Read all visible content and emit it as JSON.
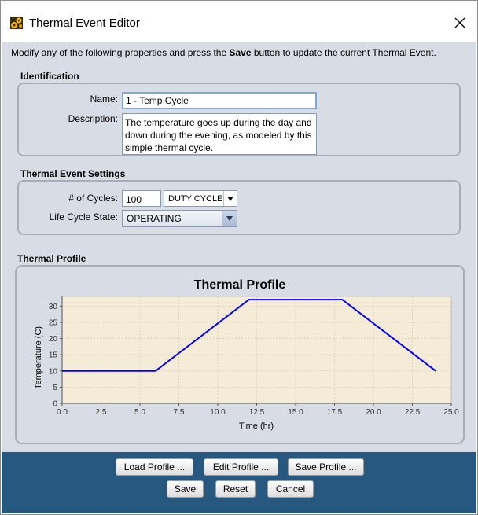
{
  "window": {
    "title": "Thermal Event Editor",
    "instructions_pre": "Modify any of the following properties and press the ",
    "instructions_bold": "Save",
    "instructions_post": " button to update the current Thermal Event."
  },
  "identification": {
    "section_title": "Identification",
    "name_label": "Name:",
    "name_value": "1 - Temp Cycle",
    "description_label": "Description:",
    "description_value": "The temperature goes up during the day and down during the evening, as modeled by this simple thermal cycle."
  },
  "settings": {
    "section_title": "Thermal Event Settings",
    "cycles_label": "# of Cycles:",
    "cycles_value": "100",
    "cycle_type_selected": "DUTY CYCLE",
    "life_cycle_label": "Life Cycle State:",
    "life_cycle_selected": "OPERATING"
  },
  "profile": {
    "section_title": "Thermal Profile"
  },
  "chart_data": {
    "type": "line",
    "title": "Thermal Profile",
    "xlabel": "Time (hr)",
    "ylabel": "Temperature (C)",
    "xlim": [
      0,
      25
    ],
    "ylim": [
      0,
      33
    ],
    "xticks": [
      0.0,
      2.5,
      5.0,
      7.5,
      10.0,
      12.5,
      15.0,
      17.5,
      20.0,
      22.5,
      25.0
    ],
    "xtick_labels": [
      "0.0",
      "2.5",
      "5.0",
      "7.5",
      "10.0",
      "12.5",
      "15.0",
      "17.5",
      "20.0",
      "22.5",
      "25.0"
    ],
    "yticks": [
      0,
      5,
      10,
      15,
      20,
      25,
      30
    ],
    "ytick_labels": [
      "0",
      "5",
      "10",
      "15",
      "20",
      "25",
      "30"
    ],
    "grid": true,
    "series": [
      {
        "x": [
          0,
          6,
          12,
          18,
          24
        ],
        "y": [
          10,
          10,
          32,
          32,
          10
        ],
        "color": "#0000ff"
      }
    ],
    "plot_background": "#f5ecd8"
  },
  "buttons": {
    "load_profile": "Load Profile ...",
    "edit_profile": "Edit Profile ...",
    "save_profile": "Save Profile ...",
    "save": "Save",
    "reset": "Reset",
    "cancel": "Cancel"
  },
  "colors": {
    "content_bg": "#d8dce5",
    "bottom_bar": "#27587f",
    "series": "#0000ff"
  }
}
